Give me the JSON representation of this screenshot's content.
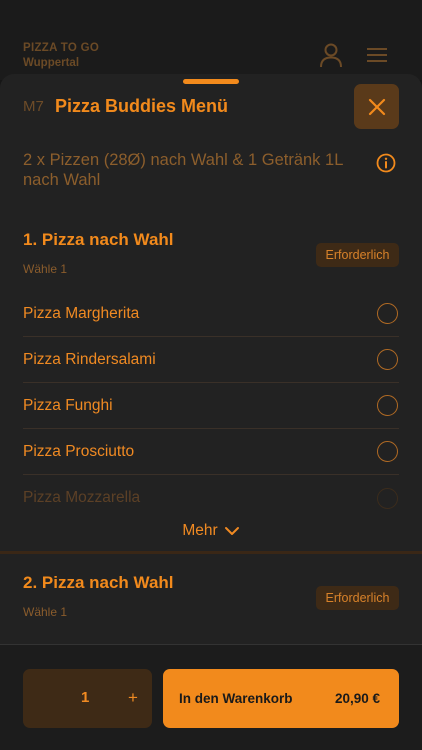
{
  "header": {
    "brand_name": "PIZZA TO GO",
    "brand_city": "Wuppertal",
    "icons": [
      "user-icon",
      "menu-icon"
    ]
  },
  "dialog": {
    "code": "M7",
    "title": "Pizza Buddies Menü",
    "description": "2 x Pizzen (28Ø) nach Wahl & 1 Getränk 1L nach Wahl",
    "close_icon": "close-icon",
    "info_icon": "info-icon"
  },
  "groups": [
    {
      "title": "1. Pizza nach Wahl",
      "subtitle": "Wähle 1",
      "badge": "Erforderlich",
      "options": [
        {
          "label": "Pizza Margherita",
          "selected": false
        },
        {
          "label": "Pizza Rindersalami",
          "selected": false
        },
        {
          "label": "Pizza Funghi",
          "selected": false
        },
        {
          "label": "Pizza Prosciutto",
          "selected": false
        },
        {
          "label": "Pizza Mozzarella",
          "selected": false
        }
      ],
      "more_label": "Mehr"
    },
    {
      "title": "2. Pizza nach Wahl",
      "subtitle": "Wähle 1",
      "badge": "Erforderlich"
    }
  ],
  "footer": {
    "quantity": "1",
    "plus_label": "+",
    "cart_label": "In den Warenkorb",
    "price": "20,90 €"
  },
  "colors": {
    "accent": "#f28a1c",
    "background": "#161616",
    "sheet": "#222222",
    "badge_bg": "#3e2a16"
  }
}
